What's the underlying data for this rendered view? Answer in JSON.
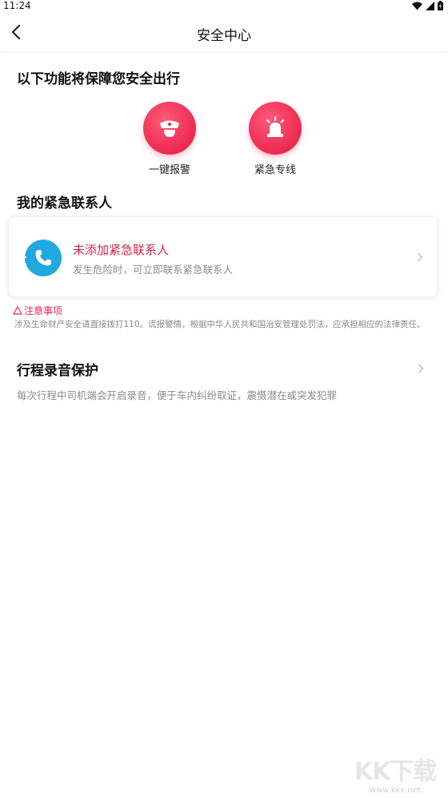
{
  "status_bar": {
    "time": "11:24"
  },
  "nav": {
    "title": "安全中心"
  },
  "features": {
    "heading": "以下功能将保障您安全出行",
    "items": [
      {
        "label": "一键报警",
        "icon": "police-cap-icon"
      },
      {
        "label": "紧急专线",
        "icon": "alarm-siren-icon"
      }
    ]
  },
  "contacts": {
    "heading": "我的紧急联系人",
    "card_title": "未添加紧急联系人",
    "card_subtitle": "发生危险时，可立即联系紧急联系人"
  },
  "notice": {
    "title": "注意事项",
    "body": "涉及生命财产安全请直接拨打110。谎报警情，根据中华人民共和国治安管理处罚法，应承担相应的法律责任。"
  },
  "recording": {
    "title": "行程录音保护",
    "description": "每次行程中司机端会开启录音，便于车内纠纷取证，震慑潜在或突发犯罪"
  },
  "watermark": {
    "logo": "KK下载",
    "url": "www.kkx.net"
  },
  "colors": {
    "accent": "#ec2a4f",
    "phone_blue": "#22a8e0",
    "text_muted": "#8a8a8a"
  }
}
